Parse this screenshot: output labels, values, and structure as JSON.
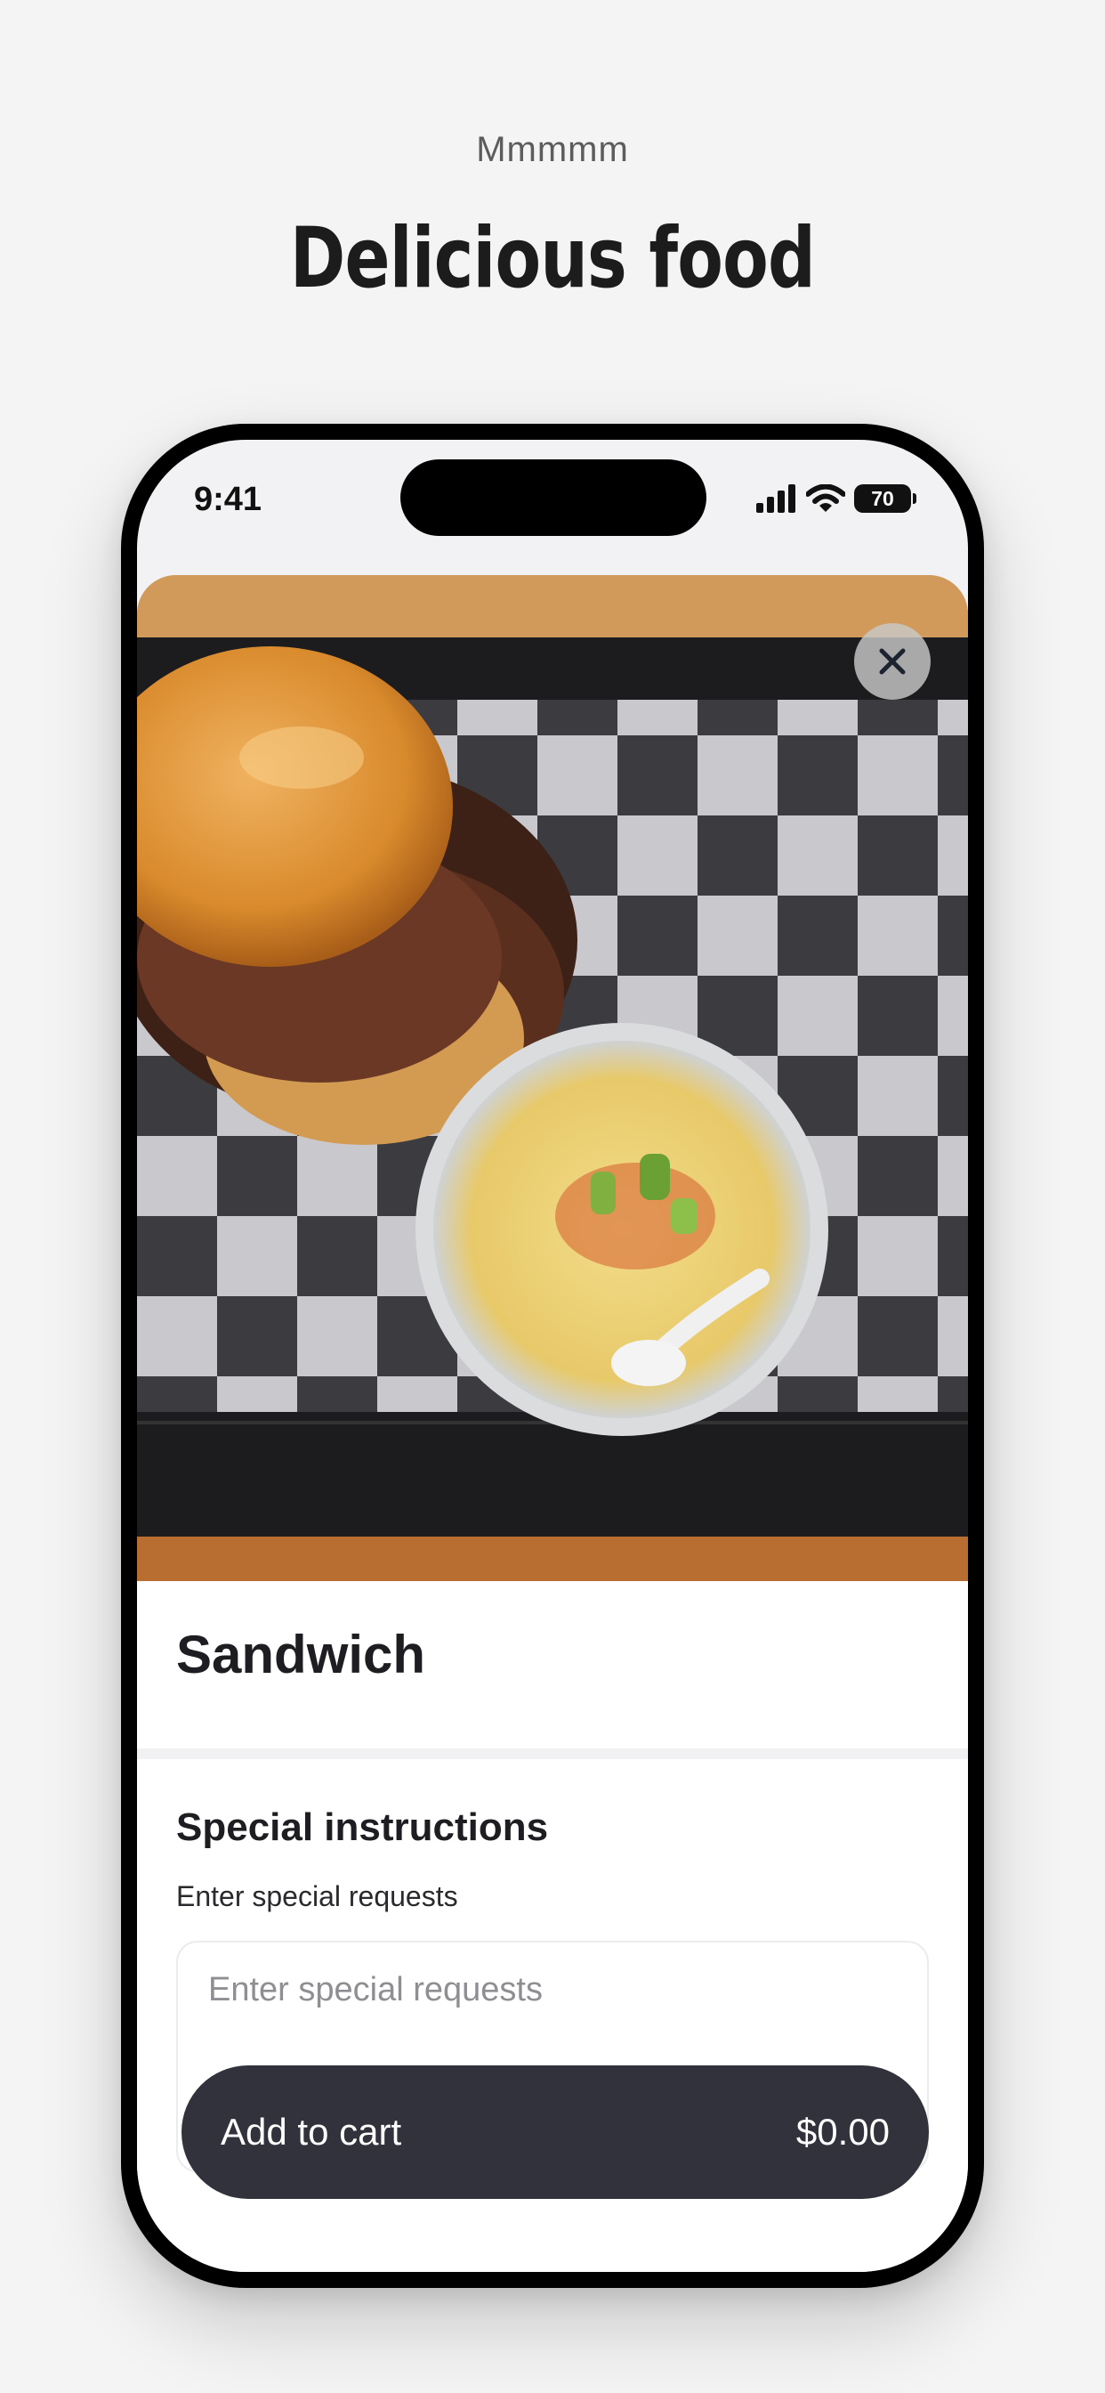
{
  "hero": {
    "eyebrow": "Mmmmm",
    "headline": "Delicious food"
  },
  "status_bar": {
    "time": "9:41",
    "battery": "70",
    "icons": [
      "signal-icon",
      "wifi-icon",
      "battery-icon"
    ]
  },
  "item": {
    "photo_icon": "food-photo",
    "close_icon": "close-icon",
    "name": "Sandwich"
  },
  "instructions": {
    "title": "Special instructions",
    "subtitle": "Enter special requests",
    "placeholder": "Enter special requests",
    "value": ""
  },
  "cart": {
    "label": "Add to cart",
    "price": "$0.00"
  },
  "colors": {
    "page_background": "#f4f4f4",
    "button_background": "#32323c",
    "text_primary": "#1e1e22"
  }
}
